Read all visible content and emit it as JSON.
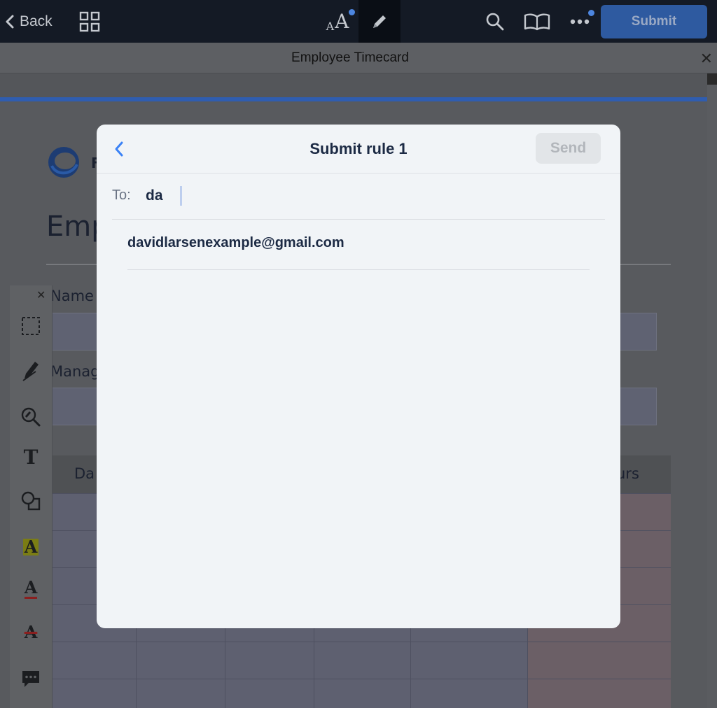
{
  "toolbar": {
    "back_label": "Back",
    "font_icon_small": "A",
    "font_icon_large": "A",
    "submit_label": "Submit"
  },
  "document": {
    "title": "Employee Timecard",
    "logo_letter": "F",
    "heading": "Emp",
    "name_label": "Name",
    "manager_label": "Manag",
    "table_col_first": "Da",
    "table_col_last": "urs"
  },
  "left_toolbar": {
    "text_tool": "T",
    "highlight_tool": "A",
    "underline_tool": "A",
    "strikeout_tool": "A"
  },
  "modal": {
    "title": "Submit rule 1",
    "send_label": "Send",
    "to_label": "To:",
    "to_value": "da",
    "suggestions": [
      "davidlarsenexample@gmail.com"
    ]
  },
  "colors": {
    "accent": "#2e5aa0",
    "highlight": "#e3e600",
    "markup_red": "#c41f1f",
    "link_blue": "#3b82f6"
  }
}
